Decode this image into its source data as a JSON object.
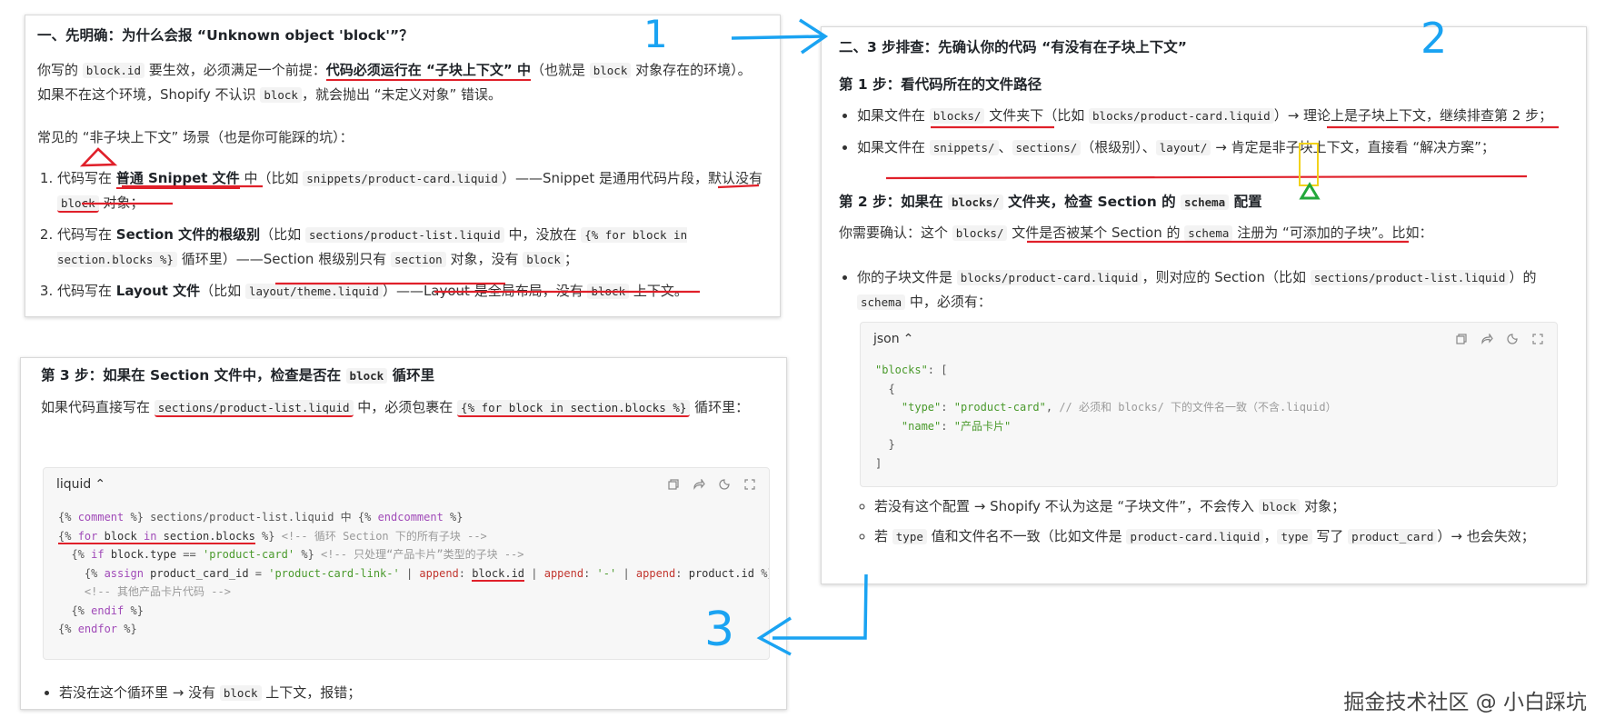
{
  "card1": {
    "title": "一、先明确：为什么会报 “Unknown object 'block'”？",
    "p1": {
      "a": "你写的 ",
      "code1": "block.id",
      "b": " 要生效，必须满足一个前提：",
      "strong": "代码必须运行在 “子块上下文” 中",
      "c": "（也就是 ",
      "code2": "block",
      "d": " 对象存在的环境）。如果不在这个环境，Shopify 不认识 ",
      "code3": "block",
      "e": "，就会抛出 “未定义对象” 错误。"
    },
    "p2": "常见的 “非子块上下文” 场景（也是你可能踩的坑）：",
    "items": [
      {
        "a": "代码写在 ",
        "strong": "普通 Snippet 文件",
        "b": " 中（比如 ",
        "code": "snippets/product-card.liquid",
        "c": "）——Snippet 是通用代码片段，默认没有 ",
        "code2": "block",
        "d": " 对象；"
      },
      {
        "a": "代码写在 ",
        "strong": "Section 文件的根级别",
        "b": "（比如 ",
        "code": "sections/product-list.liquid",
        "c": " 中，没放在 ",
        "code2": "{% for block in section.blocks %}",
        "d": " 循环里）——Section 根级别只有 ",
        "code3": "section",
        "e": " 对象，没有 ",
        "code4": "block",
        "f": "；"
      },
      {
        "a": "代码写在 ",
        "strong": "Layout 文件",
        "b": "（比如 ",
        "code": "layout/theme.liquid",
        "c": "）——Layout 是全局布局，没有 ",
        "code2": "block",
        "d": " 上下文。"
      }
    ]
  },
  "card2": {
    "title": "二、3 步排查：先确认你的代码 “有没有在子块上下文”",
    "step1": "第 1 步：看代码所在的文件路径",
    "b1": {
      "a": "如果文件在 ",
      "code": "blocks/",
      "b": " 文件夹下（比如 ",
      "code2": "blocks/product-card.liquid",
      "c": "）→ 理论上是子块上下文，继续排查第 2 步；"
    },
    "b2": {
      "a": "如果文件在 ",
      "code": "snippets/",
      "b": "、",
      "code2": "sections/",
      "c": "（根级别）、",
      "code3": "layout/",
      "d": " → 肯定是非子块上下文，直接看 “解决方案”；"
    },
    "step2": {
      "a": "第 2 步：如果在 ",
      "code": "blocks/",
      "b": " 文件夹，检查 Section 的 ",
      "code2": "schema",
      "c": " 配置"
    },
    "p": {
      "a": "你需要确认：这个 ",
      "code": "blocks/",
      "b": " 文件是否被某个 Section 的 ",
      "code2": "schema",
      "c": " 注册为 “可添加的子块”。比如："
    },
    "b3": {
      "a": "你的子块文件是 ",
      "code": "blocks/product-card.liquid",
      "b": "，则对应的 Section（比如 ",
      "code2": "sections/product-list.liquid",
      "c": "）的 ",
      "code3": "schema",
      "d": " 中，必须有："
    },
    "codebox": {
      "lang": "json",
      "lines": [
        "\"blocks\": [",
        "  {",
        "    \"type\": \"product-card\", // 必须和 blocks/ 下的文件名一致（不含.liquid）",
        "    \"name\": \"产品卡片\"",
        "  }",
        "]"
      ]
    },
    "c1": {
      "a": "若没有这个配置 → Shopify 不认为这是 “子块文件”，不会传入 ",
      "code": "block",
      "b": " 对象；"
    },
    "c2": {
      "a": "若 ",
      "code": "type",
      "b": " 值和文件名不一致（比如文件是 ",
      "code2": "product-card.liquid",
      "c": "，",
      "code3": "type",
      "d": " 写了 ",
      "code4": "product_card",
      "e": "）→ 也会失效；"
    }
  },
  "card3": {
    "title": {
      "a": "第 3 步：如果在 Section 文件中，检查是否在 ",
      "code": "block",
      "b": " 循环里"
    },
    "p": {
      "a": "如果代码直接写在 ",
      "code": "sections/product-list.liquid",
      "b": " 中，必须包裹在 ",
      "code2": "{% for block in section.blocks %}",
      "c": " 循环里："
    },
    "codebox": {
      "lang": "liquid",
      "lines": [
        "{% comment %} sections/product-list.liquid 中 {% endcomment %}",
        "{% for block in section.blocks %} <!-- 循环 Section 下的所有子块 -->",
        "  {% if block.type == 'product-card' %} <!-- 只处理“产品卡片”类型的子块 -->",
        "    {% assign product_card_id = 'product-card-link-' | append: block.id | append: '-' | append: product.id %}",
        "    <!-- 其他产品卡片代码 -->",
        "  {% endif %}",
        "{% endfor %}"
      ]
    },
    "bullet": {
      "a": "若没在这个循环里 → 没有 ",
      "code": "block",
      "b": " 上下文，报错；"
    }
  },
  "annotations": {
    "num1": "1",
    "num2": "2",
    "num3": "3"
  },
  "watermark": "掘金技术社区 @ 小白踩坑",
  "colors": {
    "underline": "#e0202a",
    "blue_annotation": "#1aa3f2",
    "green_annotation": "#22a83a",
    "yellow_box": "#f2d21b"
  }
}
